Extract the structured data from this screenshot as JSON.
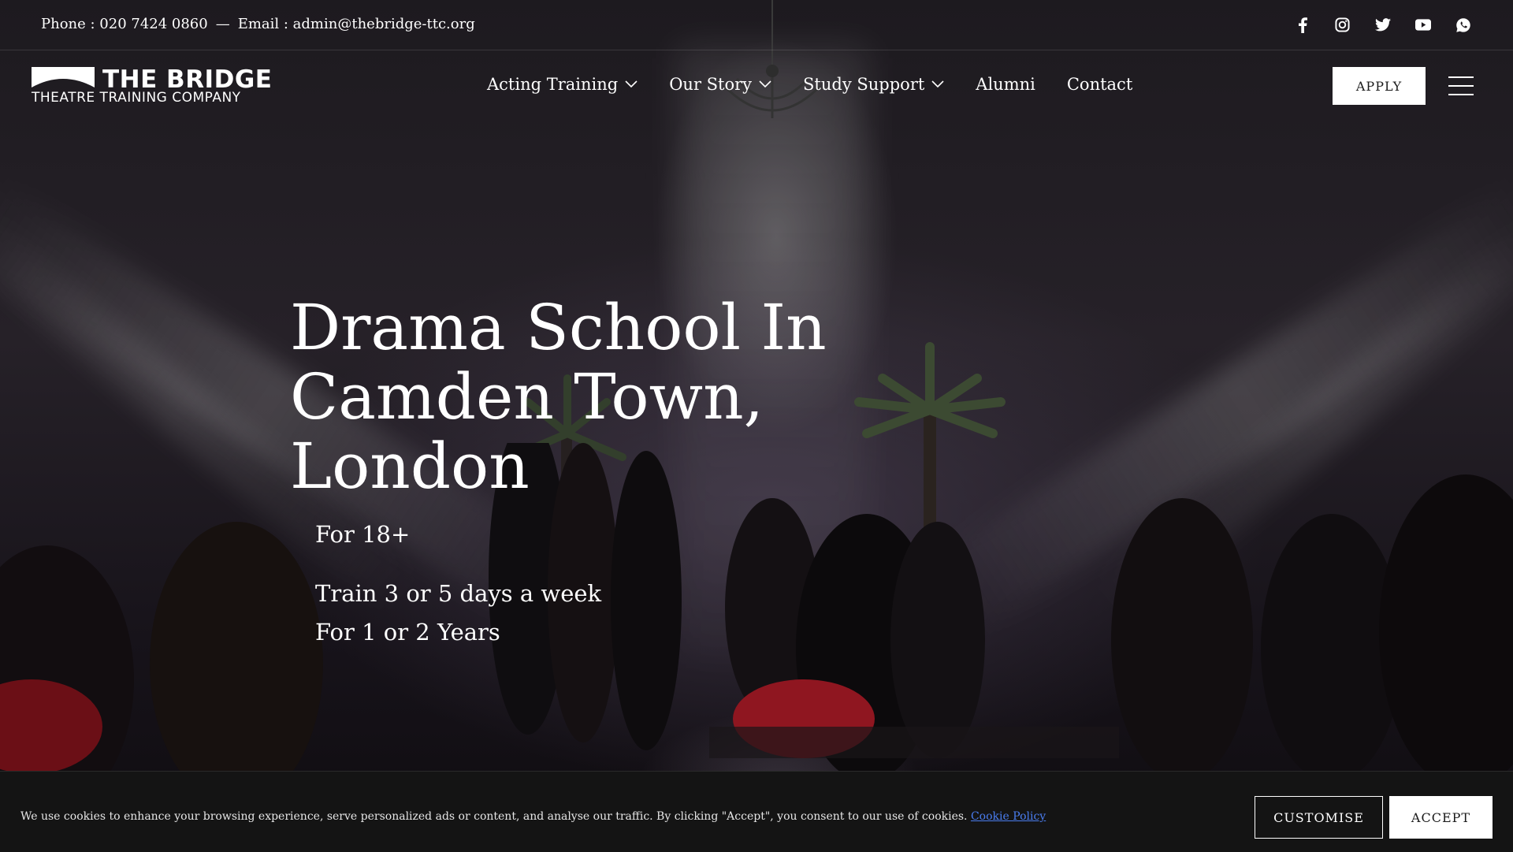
{
  "topbar": {
    "phone": "Phone : 020 7424 0860",
    "separator": "—",
    "email": "Email : admin@thebridge-ttc.org",
    "socials": [
      "facebook-icon",
      "instagram-icon",
      "twitter-icon",
      "youtube-icon",
      "whatsapp-icon"
    ]
  },
  "logo": {
    "line1": "THE BRIDGE",
    "line2": "THEATRE TRAINING COMPANY"
  },
  "nav": {
    "items": [
      {
        "label": "Acting Training",
        "has_dropdown": true
      },
      {
        "label": "Our Story",
        "has_dropdown": true
      },
      {
        "label": "Study Support",
        "has_dropdown": true
      },
      {
        "label": "Alumni",
        "has_dropdown": false
      },
      {
        "label": "Contact",
        "has_dropdown": false
      }
    ],
    "apply_label": "APPLY",
    "menu_icon": "hamburger-menu-icon"
  },
  "hero": {
    "title": "Drama School In Camden Town, London",
    "sub1": "For 18+",
    "sub2": "Train 3 or 5 days a week",
    "sub3": "For 1 or 2 Years"
  },
  "cookie": {
    "text": "We use cookies to enhance your browsing experience, serve personalized ads or content, and analyse our traffic. By clicking \"Accept\", you consent to our use of cookies.",
    "link": "Cookie Policy",
    "customise_label": "CUSTOMISE",
    "accept_label": "ACCEPT"
  },
  "colors": {
    "link": "#4a7df0",
    "cookie_bg": "#141414",
    "button_bg": "#ffffff"
  }
}
